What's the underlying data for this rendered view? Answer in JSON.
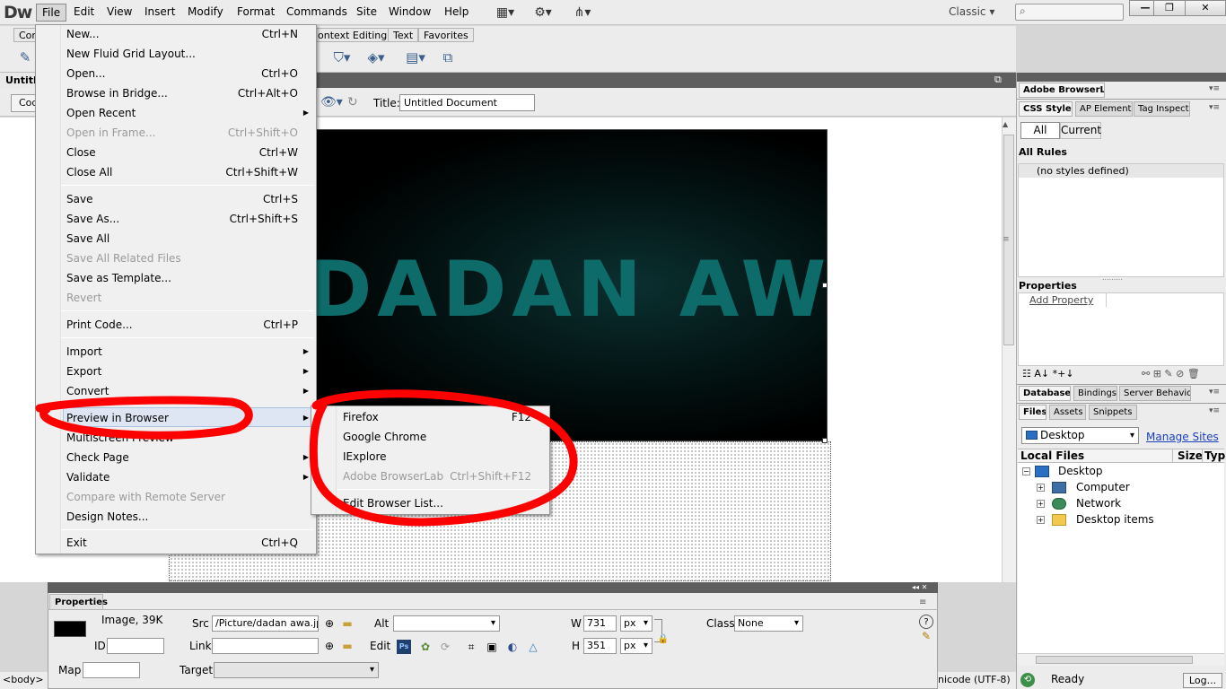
{
  "app": {
    "logo": "Dw",
    "menus": [
      "File",
      "Edit",
      "View",
      "Insert",
      "Modify",
      "Format",
      "Commands",
      "Site",
      "Window",
      "Help"
    ],
    "toolbar_icons": [
      "layout-icon",
      "gear-icon",
      "site-icon"
    ],
    "workspace": "Classic",
    "window_buttons": [
      "minimize",
      "restore",
      "close"
    ]
  },
  "insert_bar": {
    "tabs": [
      "Com",
      "ontext Editing",
      "Text",
      "Favorites"
    ]
  },
  "document": {
    "tab": "Untitle",
    "code_button": "Cod",
    "title_label": "Title:",
    "title_value": "Untitled Document",
    "image_text": "DADAN AWA"
  },
  "file_menu": {
    "items": [
      {
        "label": "New...",
        "shortcut": "Ctrl+N"
      },
      {
        "label": "New Fluid Grid Layout...",
        "shortcut": ""
      },
      {
        "label": "Open...",
        "shortcut": "Ctrl+O"
      },
      {
        "label": "Browse in Bridge...",
        "shortcut": "Ctrl+Alt+O"
      },
      {
        "label": "Open Recent",
        "shortcut": "",
        "submenu": true
      },
      {
        "label": "Open in Frame...",
        "shortcut": "Ctrl+Shift+O",
        "disabled": true
      },
      {
        "label": "Close",
        "shortcut": "Ctrl+W"
      },
      {
        "label": "Close All",
        "shortcut": "Ctrl+Shift+W"
      },
      {
        "label": "Save",
        "shortcut": "Ctrl+S"
      },
      {
        "label": "Save As...",
        "shortcut": "Ctrl+Shift+S"
      },
      {
        "label": "Save All",
        "shortcut": ""
      },
      {
        "label": "Save All Related Files",
        "shortcut": "",
        "disabled": true
      },
      {
        "label": "Save as Template...",
        "shortcut": ""
      },
      {
        "label": "Revert",
        "shortcut": "",
        "disabled": true
      },
      {
        "label": "Print Code...",
        "shortcut": "Ctrl+P"
      },
      {
        "label": "Import",
        "shortcut": "",
        "submenu": true
      },
      {
        "label": "Export",
        "shortcut": "",
        "submenu": true
      },
      {
        "label": "Convert",
        "shortcut": "",
        "submenu": true
      },
      {
        "label": "Preview in Browser",
        "shortcut": "",
        "submenu": true,
        "highlighted": true
      },
      {
        "label": "Multiscreen Preview",
        "shortcut": ""
      },
      {
        "label": "Check Page",
        "shortcut": "",
        "submenu": true
      },
      {
        "label": "Validate",
        "shortcut": "",
        "submenu": true
      },
      {
        "label": "Compare with Remote Server",
        "shortcut": "",
        "disabled": true
      },
      {
        "label": "Design Notes...",
        "shortcut": ""
      },
      {
        "label": "Exit",
        "shortcut": "Ctrl+Q"
      }
    ]
  },
  "browser_submenu": {
    "items": [
      {
        "label": "Firefox",
        "shortcut": "F12"
      },
      {
        "label": "Google Chrome",
        "shortcut": ""
      },
      {
        "label": "IExplore",
        "shortcut": ""
      },
      {
        "label": "Adobe BrowserLab",
        "shortcut": "Ctrl+Shift+F12",
        "disabled": true
      },
      {
        "label": "Edit Browser List...",
        "shortcut": ""
      }
    ]
  },
  "properties": {
    "tab": "Properties",
    "image_info": "Image, 39K",
    "id_label": "ID",
    "id_value": "",
    "src_label": "Src",
    "src_value": "/Picture/dadan awa.jpg",
    "link_label": "Link",
    "link_value": "",
    "alt_label": "Alt",
    "alt_value": "",
    "edit_label": "Edit",
    "w_label": "W",
    "w_value": "731",
    "h_label": "H",
    "h_value": "351",
    "unit": "px",
    "class_label": "Class",
    "class_value": "None",
    "map_label": "Map",
    "map_value": "",
    "target_label": "Target",
    "ps_badge": "Ps"
  },
  "status": {
    "tag": "<body> <",
    "encoding": "nicode (UTF-8)",
    "ready": "Ready",
    "log_button": "Log..."
  },
  "panels": {
    "browserlab": "Adobe BrowserLab",
    "css_tabs": [
      "CSS Styles",
      "AP Elements",
      "Tag Inspecto"
    ],
    "css_all": "All",
    "css_current": "Current",
    "all_rules": "All Rules",
    "no_styles": "(no styles defined)",
    "properties_title": "Properties",
    "add_property": "Add Property",
    "db_tabs": [
      "Databases",
      "Bindings",
      "Server Behavior"
    ],
    "files_tabs": [
      "Files",
      "Assets",
      "Snippets"
    ],
    "files_location": "Desktop",
    "manage_sites": "Manage Sites",
    "local_files": "Local Files",
    "size": "Size",
    "type": "Typ",
    "tree": [
      "Desktop",
      "Computer",
      "Network",
      "Desktop items"
    ]
  },
  "colors": {
    "annotation": "#ff0000",
    "menu_highlight": "#dde6f2",
    "image_text": "#0d6b69"
  }
}
